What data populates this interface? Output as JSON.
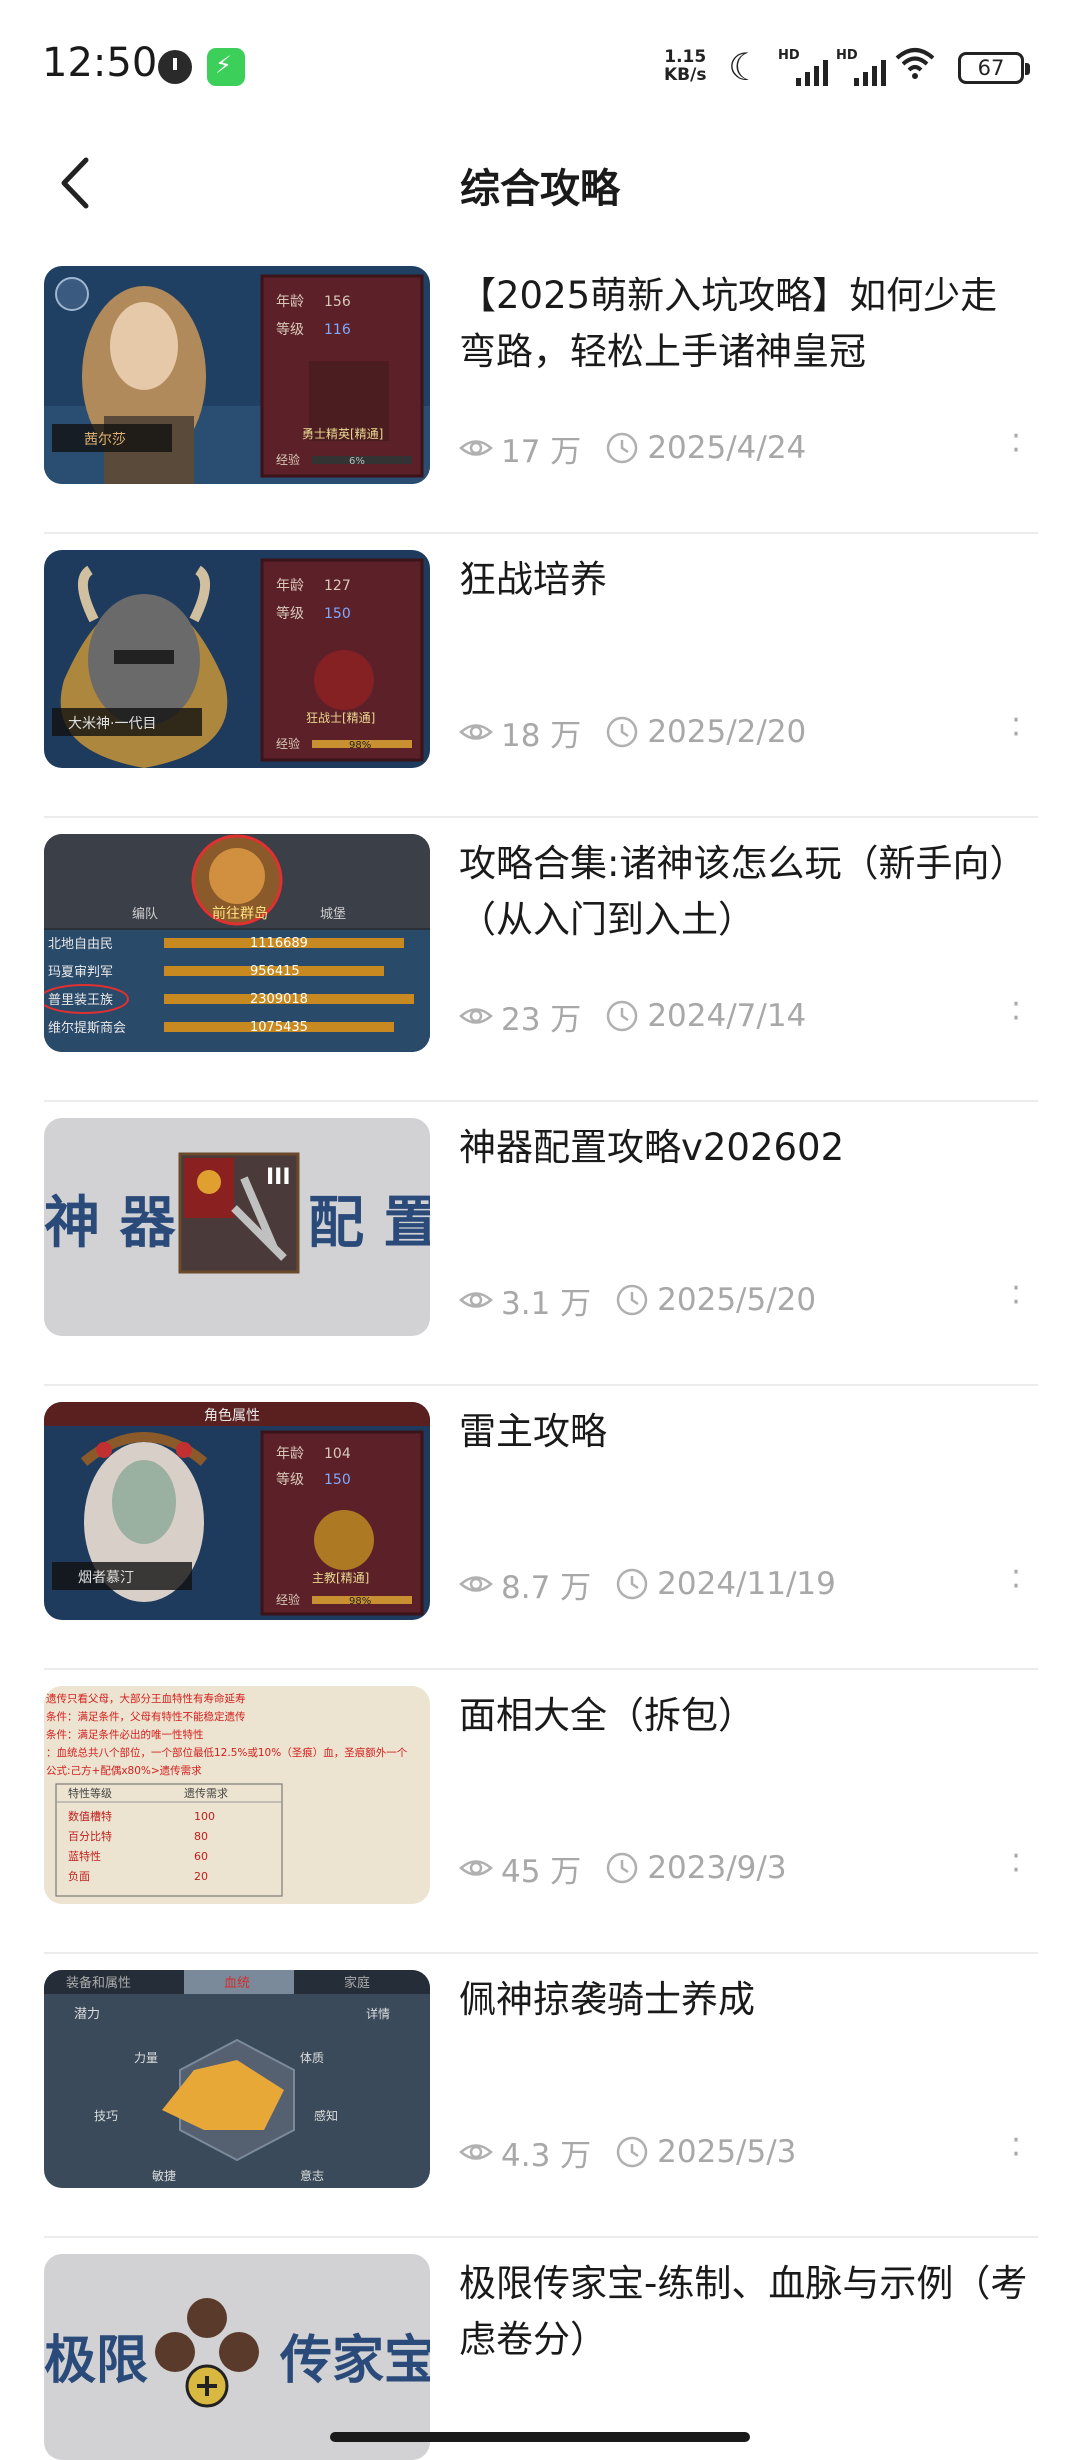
{
  "status_bar": {
    "time": "12:50",
    "net_speed_value": "1.15",
    "net_speed_unit": "KB/s",
    "signal_label": "HD",
    "battery": "67"
  },
  "header": {
    "title": "综合攻略"
  },
  "articles": [
    {
      "title": "【2025萌新入坑攻略】如何少走弯路，轻松上手诸神皇冠",
      "views": "17 万",
      "date": "2025/4/24"
    },
    {
      "title": "狂战培养",
      "views": "18 万",
      "date": "2025/2/20"
    },
    {
      "title": "攻略合集:诸神该怎么玩（新手向）（从入门到入土）",
      "views": "23 万",
      "date": "2024/7/14"
    },
    {
      "title": "神器配置攻略v202602",
      "views": "3.1 万",
      "date": "2025/5/20"
    },
    {
      "title": "雷主攻略",
      "views": "8.7 万",
      "date": "2024/11/19"
    },
    {
      "title": "面相大全（拆包）",
      "views": "45 万",
      "date": "2023/9/3"
    },
    {
      "title": "佩神掠袭骑士养成",
      "views": "4.3 万",
      "date": "2025/5/3"
    },
    {
      "title": "极限传家宝-练制、血脉与示例（考虑卷分）",
      "views": "",
      "date": ""
    }
  ],
  "thumbs": {
    "t1": {
      "name": "茜尔莎",
      "age_label": "年龄",
      "age": "156",
      "level_label": "等级",
      "level": "116",
      "class": "勇士精英[精通]",
      "exp_label": "经验",
      "exp": "6%"
    },
    "t2": {
      "name": "大米神·一代目",
      "age_label": "年龄",
      "age": "127",
      "level_label": "等级",
      "level": "150",
      "class": "狂战士[精通]",
      "exp_label": "经验",
      "exp": "98%"
    },
    "t3": {
      "banner": "前往群岛",
      "tab_left": "编队",
      "tab_right": "城堡",
      "rows": [
        [
          "北地自由民",
          "1116689"
        ],
        [
          "玛夏审判军",
          "956415"
        ],
        [
          "普里装王族",
          "2309018"
        ],
        [
          "维尔提斯商会",
          "1075435"
        ]
      ]
    },
    "t4": {
      "left_text": "神 器",
      "right_text": "配 置",
      "badge": "III"
    },
    "t5": {
      "header": "角色属性",
      "name": "烟者慕汀",
      "age_label": "年龄",
      "age": "104",
      "level_label": "等级",
      "level": "150",
      "class": "主教[精通]",
      "exp_label": "经验",
      "exp": "98%"
    },
    "t6": {
      "lines": [
        "遗传只看父母，大部分王血特性有寿命延寿",
        "条件：满足条件，父母有特性不能稳定遗传",
        "条件：满足条件必出的唯一性特性",
        "：血统总共八个部位，一个部位最低12.5%或10%（圣痕）血，圣痕额外一个",
        "公式:己方+配偶x80%>遗传需求"
      ],
      "table_headers": [
        "特性等级",
        "遗传需求"
      ],
      "table_rows": [
        [
          "数值槽特",
          "100"
        ],
        [
          "百分比特",
          "80"
        ],
        [
          "蓝特性",
          "60"
        ],
        [
          "负面",
          "20"
        ]
      ]
    },
    "t7": {
      "tabs": [
        "装备和属性",
        "血统",
        "家庭"
      ],
      "potential": "潜力",
      "detail": "详情",
      "stats": [
        "力量",
        "体质",
        "技巧",
        "感知",
        "敏捷",
        "意志"
      ]
    },
    "t8": {
      "left_text": "极限",
      "right_text": "传家宝"
    }
  }
}
